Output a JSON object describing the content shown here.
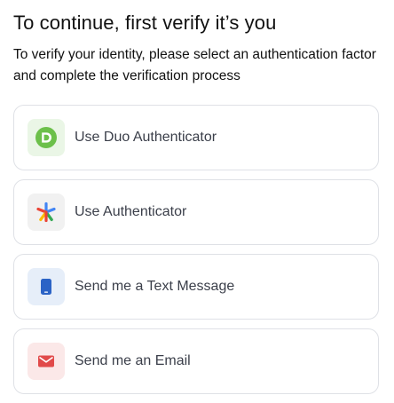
{
  "header": {
    "title": "To continue, first verify it’s you",
    "subtitle": "To verify your identity, please select an authentication factor and complete the verification process"
  },
  "options": [
    {
      "label": "Use Duo Authenticator",
      "icon": "duo-icon",
      "icon_bg": "#eaf6e6",
      "icon_color": "#6cc04a"
    },
    {
      "label": "Use Authenticator",
      "icon": "authenticator-asterisk-icon",
      "icon_bg": "#f1f1f1",
      "icon_colors": [
        "#4285f4",
        "#ea4335",
        "#fbbc04",
        "#34a853"
      ]
    },
    {
      "label": "Send me a Text Message",
      "icon": "phone-icon",
      "icon_bg": "#e6eef9",
      "icon_color": "#2b63c6"
    },
    {
      "label": "Send me an Email",
      "icon": "mail-icon",
      "icon_bg": "#fbe8e8",
      "icon_color": "#e14a4a"
    }
  ]
}
